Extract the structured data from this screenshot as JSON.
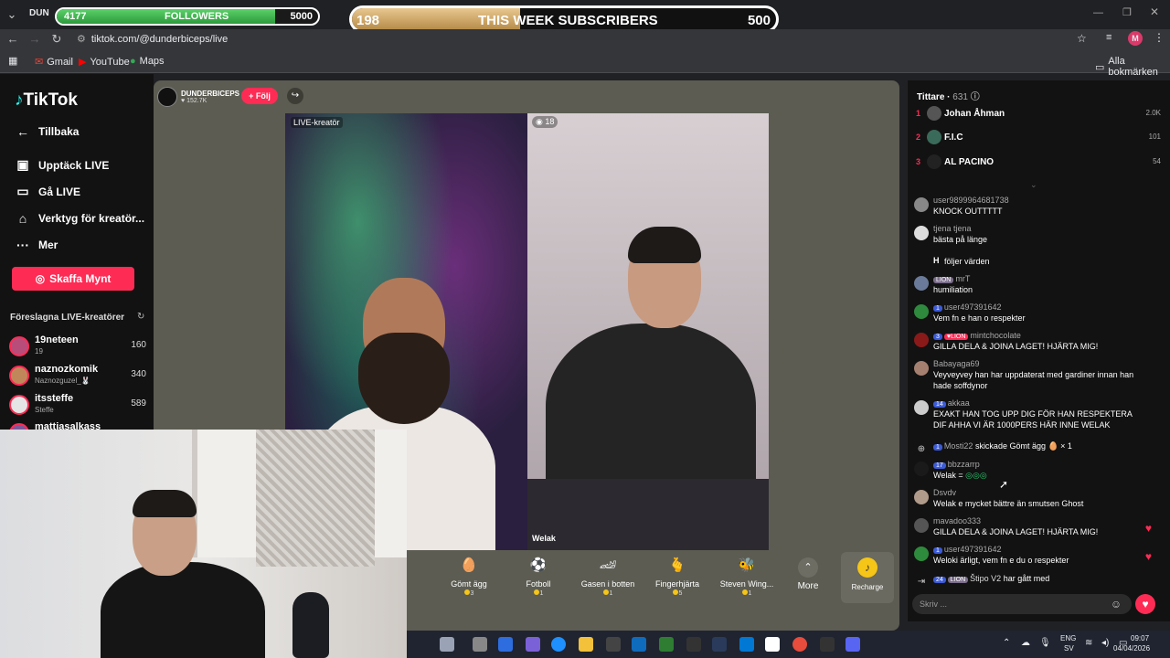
{
  "browser": {
    "tab_label": "DUN",
    "url": "tiktok.com/@dunderbiceps/live",
    "bookmarks": [
      "Gmail",
      "YouTube",
      "Maps"
    ],
    "all_bookmarks": "Alla bokmärken",
    "profile_initial": "M"
  },
  "overlay": {
    "followers": {
      "current": "4177",
      "label": "FOLLOWERS",
      "goal": "5000",
      "progress": 0.835
    },
    "subscribers": {
      "current": "198",
      "label": "THIS WEEK SUBSCRIBERS",
      "goal": "500",
      "progress": 0.396
    }
  },
  "sidebar": {
    "logo": "TikTok",
    "back": "Tillbaka",
    "items": [
      {
        "label": "Upptäck LIVE",
        "icon": "live-icon"
      },
      {
        "label": "Gå LIVE",
        "icon": "camera-icon"
      },
      {
        "label": "Verktyg för kreatör...",
        "icon": "tools-icon"
      },
      {
        "label": "Mer",
        "icon": "more-icon"
      }
    ],
    "coins_button": "Skaffa Mynt",
    "suggested_title": "Föreslagna LIVE-kreatörer",
    "creators": [
      {
        "name": "19neteen",
        "sub": "19",
        "count": "160"
      },
      {
        "name": "naznozkomik",
        "sub": "Naznozguzel_🐰",
        "count": "340"
      },
      {
        "name": "itssteffe",
        "sub": "Steffe",
        "count": "589"
      },
      {
        "name": "mattiasalkass",
        "sub": "",
        "count": ""
      }
    ]
  },
  "stream": {
    "host_name": "DUNDERBICEPS",
    "host_likes": "152.7K",
    "follow_label": "+ Följ",
    "live_label": "LIVE-kreatör",
    "guest_count": "18",
    "guest_name": "Welak"
  },
  "gifts": [
    {
      "name": "Gömt ägg",
      "price": "3",
      "icon": "🥚"
    },
    {
      "name": "Fotboll",
      "price": "1",
      "icon": "⚽"
    },
    {
      "name": "Gasen i botten",
      "price": "1",
      "icon": "🏎"
    },
    {
      "name": "Fingerhjärta",
      "price": "5",
      "icon": "🫰"
    },
    {
      "name": "Steven Wing...",
      "price": "1",
      "icon": "🐝"
    }
  ],
  "more_label": "More",
  "recharge_label": "Recharge",
  "chat": {
    "viewers_label": "Tittare",
    "viewers_count": "631",
    "ranking": [
      {
        "rank": "1",
        "name": "Johan Åhman",
        "value": "2.0K"
      },
      {
        "rank": "2",
        "name": "F.I.C",
        "value": "101"
      },
      {
        "rank": "3",
        "name": "AL PACINO",
        "value": "54"
      }
    ],
    "messages": [
      {
        "user": "user9899964681738",
        "badge": "",
        "text": "KNOCK OUTTTTT"
      },
      {
        "user": "tjena tjena",
        "badge": "",
        "text": "bästa på länge"
      },
      {
        "user": "H",
        "badge": "",
        "text": "följer värden"
      },
      {
        "user": "mrT",
        "badge": "LION",
        "text": "humiliation"
      },
      {
        "user": "user497391642",
        "badge": "1",
        "text": "Vem fn e han o respekter"
      },
      {
        "user": "mintchocolate",
        "badge": "3",
        "text": "GILLA DELA & JOINA LAGET! HJÄRTA MIG!"
      },
      {
        "user": "Babayaga69",
        "badge": "",
        "text": "Veyveyvey han har uppdaterat med gardiner innan han hade soffdynor"
      },
      {
        "user": "akkaa",
        "badge": "14",
        "text": "EXAKT HAN TOG UPP DIG FÖR HAN RESPEKTERA DIF AHHA VI ÄR 1000PERS HÄR INNE WELAK"
      },
      {
        "user": "Mosti22",
        "badge": "1",
        "text": "skickade Gömt ägg 🥚 × 1"
      },
      {
        "user": "bbzzarrp",
        "badge": "17",
        "text": "Welak ="
      },
      {
        "user": "Dsvdv",
        "badge": "",
        "text": "Welak e mycket bättre än smutsen Ghost"
      },
      {
        "user": "mavadoo333",
        "badge": "",
        "text": "GILLA DELA & JOINA LAGET! HJÄRTA MIG!"
      },
      {
        "user": "user497391642",
        "badge": "1",
        "text": "Weloki ärligt, vem fn e du o respekter"
      },
      {
        "user": "Štipo V2",
        "badge": "24",
        "text": "har gått med"
      }
    ],
    "input_placeholder": "Skriv ..."
  },
  "taskbar": {
    "lang": "ENG",
    "region": "SV",
    "time": "09:07",
    "date": "04/04/2026"
  }
}
